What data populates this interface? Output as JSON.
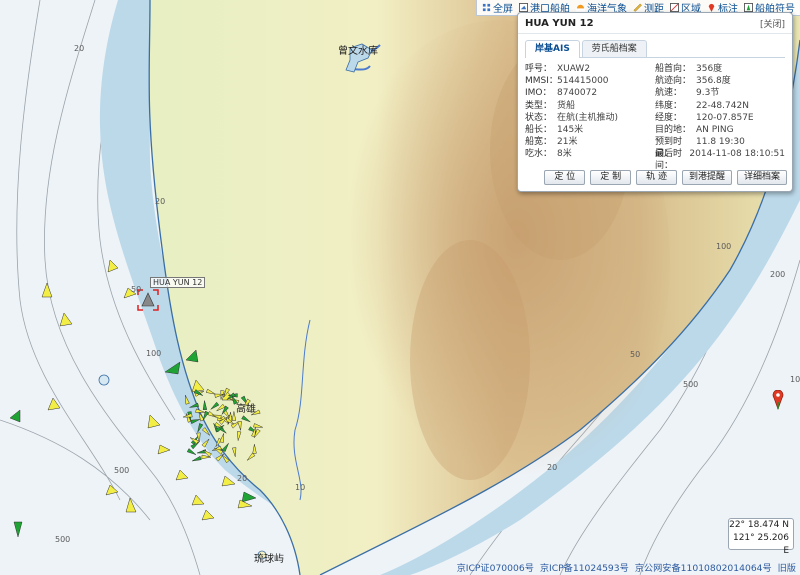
{
  "toolbar": {
    "items": [
      {
        "label": "全屏",
        "icon": "fullscreen-icon"
      },
      {
        "label": "港口船舶",
        "icon": "port-ships-icon"
      },
      {
        "label": "海洋气象",
        "icon": "weather-icon"
      },
      {
        "label": "测距",
        "icon": "ruler-icon"
      },
      {
        "label": "区域",
        "icon": "area-icon"
      },
      {
        "label": "标注",
        "icon": "marker-pin-icon"
      },
      {
        "label": "船舶符号",
        "icon": "ship-symbol-icon"
      }
    ]
  },
  "popup": {
    "title": "HUA YUN 12",
    "close": "[关闭]",
    "tabs": [
      "岸基AIS",
      "劳氏船档案"
    ],
    "left": [
      {
        "label": "呼号：",
        "value": "XUAW2"
      },
      {
        "label": "MMSI：",
        "value": "514415000"
      },
      {
        "label": "IMO：",
        "value": "8740072"
      },
      {
        "label": "类型：",
        "value": "货船"
      },
      {
        "label": "状态：",
        "value": "在航(主机推动)"
      },
      {
        "label": "船长：",
        "value": "145米"
      },
      {
        "label": "船宽：",
        "value": "21米"
      },
      {
        "label": "吃水：",
        "value": "8米"
      }
    ],
    "right": [
      {
        "label": "船首向：",
        "value": "356度"
      },
      {
        "label": "航迹向：",
        "value": "356.8度"
      },
      {
        "label": "航速：",
        "value": "9.3节"
      },
      {
        "label": "纬度：",
        "value": "22-48.742N"
      },
      {
        "label": "经度：",
        "value": "120-07.857E"
      },
      {
        "label": "目的地：",
        "value": "AN PING"
      },
      {
        "label": "预到时间：",
        "value": "11.8 19:30"
      },
      {
        "label": "最后时间：",
        "value": "2014-11-08 18:10:51"
      }
    ],
    "buttons": [
      "定 位",
      "定 制",
      "轨 迹",
      "到港提醒",
      "详细档案"
    ]
  },
  "map": {
    "ship_label": "HUA YUN 12",
    "place_names": [
      "曾文水库",
      "高雄",
      "琉球屿"
    ],
    "depth_labels": [
      "20",
      "50",
      "100",
      "100",
      "200",
      "500",
      "500",
      "20",
      "20",
      "100",
      "10",
      "20",
      "50",
      "500"
    ]
  },
  "coords": {
    "lat": "22° 18.474 N",
    "lon": "121° 25.206 E"
  },
  "footer": [
    "京ICP证070006号",
    "京ICP备11024593号",
    "京公网安备11010802014064号",
    "旧版"
  ],
  "colors": {
    "sea": "#eef3f7",
    "shallow": "#bcd9ea",
    "land_low": "#f1f4cf",
    "land_high": "#c9a57a",
    "ship_yellow": "#f3ee45",
    "ship_green": "#1fa335",
    "link": "#0b4f93"
  }
}
